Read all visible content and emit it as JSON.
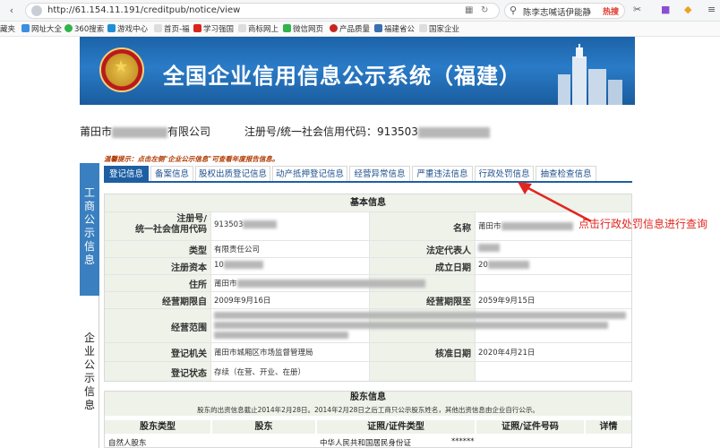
{
  "browser": {
    "url": "http://61.154.11.191/creditpub/notice/view",
    "search_text": "陈李志喊话伊能静",
    "search_hot": "热搜",
    "bookmarks": [
      "藏夹",
      "网址大全",
      "360搜索",
      "游戏中心",
      "首页-福",
      "学习强国",
      "商标网上",
      "微信网页",
      "产品质量",
      "福建省公",
      "国家企业"
    ]
  },
  "banner": {
    "title": "全国企业信用信息公示系统（福建）"
  },
  "company": {
    "name_prefix": "莆田市",
    "name_suffix": "有限公司",
    "regno_label": "注册号/统一社会信用代码：",
    "regno_value": "913503"
  },
  "tip": "温馨提示：点击左侧\"企业公示信息\"可查看年度报告信息。",
  "sidebar": {
    "top_label": "工商公示信息",
    "bottom_label": "企业公示信息"
  },
  "tabs": [
    {
      "label": "登记信息",
      "active": true
    },
    {
      "label": "备案信息",
      "active": false
    },
    {
      "label": "股权出质登记信息",
      "active": false
    },
    {
      "label": "动产抵押登记信息",
      "active": false
    },
    {
      "label": "经营异常信息",
      "active": false
    },
    {
      "label": "严重违法信息",
      "active": false
    },
    {
      "label": "行政处罚信息",
      "active": false
    },
    {
      "label": "抽查检查信息",
      "active": false
    }
  ],
  "basic_info": {
    "header": "基本信息",
    "regno_label": "注册号/\n统一社会信用代码",
    "regno_value": "913503",
    "name_label": "名称",
    "name_value": "莆田市",
    "type_label": "类型",
    "type_value": "有限责任公司",
    "legal_rep_label": "法定代表人",
    "reg_capital_label": "注册资本",
    "reg_capital_value": "10",
    "est_date_label": "成立日期",
    "est_date_value": "20",
    "address_label": "住所",
    "address_value": "莆田市",
    "term_from_label": "经营期限自",
    "term_from_value": "2009年9月16日",
    "term_to_label": "经营期限至",
    "term_to_value": "2059年9月15日",
    "scope_label": "经营范围",
    "authority_label": "登记机关",
    "authority_value": "莆田市城厢区市场监督管理局",
    "approval_date_label": "核准日期",
    "approval_date_value": "2020年4月21日",
    "status_label": "登记状态",
    "status_value": "存续（在营、开业、在册）"
  },
  "shareholders": {
    "header": "股东信息",
    "note": "股东的出资信息截止2014年2月28日。2014年2月28日之后工商只公示股东姓名，其他出资信息由企业自行公示。",
    "columns": [
      "股东类型",
      "股东",
      "证照/证件类型",
      "证照/证件号码",
      "详情"
    ],
    "row": [
      "自然人股东",
      "",
      "中华人民共和国居民身份证",
      "******",
      ""
    ]
  },
  "annotation": "点击行政处罚信息进行查询",
  "colors": {
    "accent": "#1e5fa3",
    "annotation": "#e0261f",
    "label_bg": "#eef2e9"
  }
}
